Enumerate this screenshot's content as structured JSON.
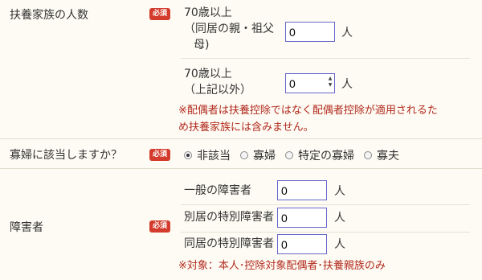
{
  "required_badge": "必須",
  "dependents": {
    "label": "扶養家族の人数",
    "over70_cohabiting": {
      "label_lines": [
        "70歳以上",
        "（同居の親・祖父",
        "母)"
      ],
      "value": "0",
      "unit": "人"
    },
    "over70_other": {
      "label_lines": [
        "70歳以上",
        "（上記以外）"
      ],
      "value": "0",
      "unit": "人"
    },
    "note_lines": [
      "※配偶者は扶養控除ではなく配偶者控除が適用されるた",
      "め扶養家族には含みません。"
    ]
  },
  "widow": {
    "label": "寡婦に該当しますか？",
    "options": [
      {
        "label": "非該当",
        "checked": true
      },
      {
        "label": "寡婦",
        "checked": false
      },
      {
        "label": "特定の寡婦",
        "checked": false
      },
      {
        "label": "寡夫",
        "checked": false
      }
    ]
  },
  "disability": {
    "label": "障害者",
    "rows": [
      {
        "label": "一般の障害者",
        "value": "0",
        "unit": "人"
      },
      {
        "label": "別居の特別障害者",
        "value": "0",
        "unit": "人"
      },
      {
        "label": "同居の特別障害者",
        "value": "0",
        "unit": "人"
      }
    ],
    "note": "※対象：本人･控除対象配偶者･扶養親族のみ"
  }
}
